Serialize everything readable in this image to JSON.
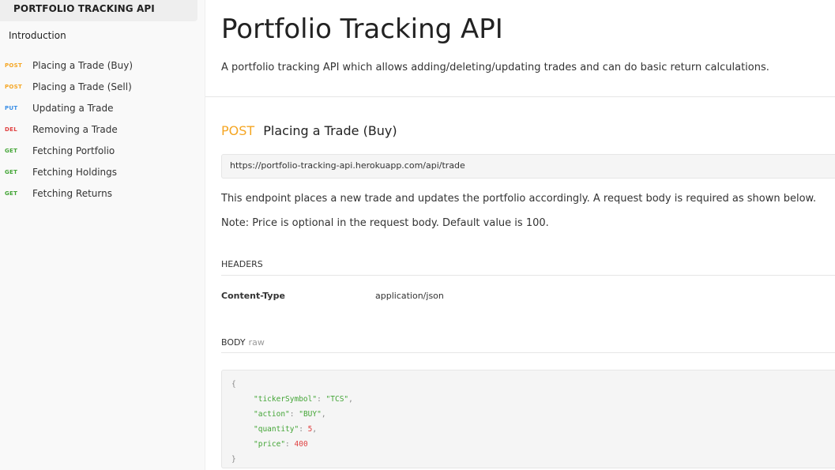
{
  "sidebar": {
    "title": "PORTFOLIO TRACKING API",
    "intro": "Introduction",
    "items": [
      {
        "method": "POST",
        "label": "Placing a Trade (Buy)"
      },
      {
        "method": "POST",
        "label": "Placing a Trade (Sell)"
      },
      {
        "method": "PUT",
        "label": "Updating a Trade"
      },
      {
        "method": "DEL",
        "label": "Removing a Trade"
      },
      {
        "method": "GET",
        "label": "Fetching Portfolio"
      },
      {
        "method": "GET",
        "label": "Fetching Holdings"
      },
      {
        "method": "GET",
        "label": "Fetching Returns"
      }
    ]
  },
  "main": {
    "title": "Portfolio Tracking API",
    "description": "A portfolio tracking API which allows adding/deleting/updating trades and can do basic return calculations."
  },
  "endpoint": {
    "method": "POST",
    "name": "Placing a Trade (Buy)",
    "url": "https://portfolio-tracking-api.herokuapp.com/api/trade",
    "description": "This endpoint places a new trade and updates the portfolio accordingly. A request body is required as shown below.",
    "note": "Note: Price is optional in the request body. Default value is 100.",
    "headers_label": "HEADERS",
    "header_key": "Content-Type",
    "header_value": "application/json",
    "body_label": "BODY",
    "body_type": "raw",
    "code": {
      "open": "{",
      "close": "}",
      "lines": [
        {
          "key": "\"tickerSymbol\"",
          "value": "\"TCS\"",
          "kind": "str",
          "comma": ","
        },
        {
          "key": "\"action\"",
          "value": "\"BUY\"",
          "kind": "str",
          "comma": ","
        },
        {
          "key": "\"quantity\"",
          "value": "5",
          "kind": "num",
          "comma": ","
        },
        {
          "key": "\"price\"",
          "value": "400",
          "kind": "num",
          "comma": ""
        }
      ]
    }
  },
  "colors": {
    "post": "#f5a623",
    "put": "#3a8ee6",
    "del": "#e04141",
    "get": "#43a536"
  }
}
